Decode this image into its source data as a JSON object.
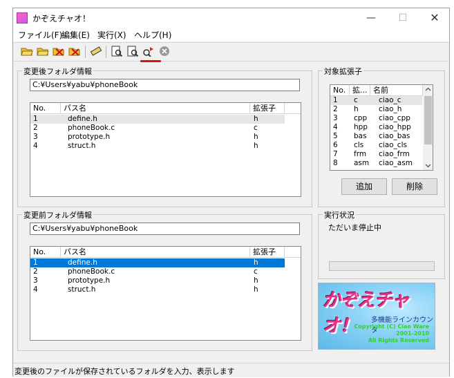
{
  "window": {
    "title": "かぞえチャオ！",
    "min_glyph": "—",
    "max_glyph": "☐",
    "close_glyph": "✕"
  },
  "menu": {
    "items": [
      "ファイル(F)",
      "編集(E)",
      "実行(X)",
      "ヘルプ(H)"
    ]
  },
  "toolbar": {
    "icons": [
      "open-folder-icon",
      "open-folder-icon",
      "remove-folder-icon",
      "remove-folder-icon",
      "ruler-icon",
      "preview-icon",
      "preview-icon",
      "count-run-icon",
      "stop-icon"
    ],
    "accent_red": "#e01010"
  },
  "after_folder": {
    "title": "変更後フォルダ情報",
    "path": "C:¥Users¥yabu¥phoneBook",
    "columns": [
      "No.",
      "パス名",
      "拡張子"
    ],
    "rows": [
      {
        "no": "1",
        "path": "define.h",
        "ext": "h"
      },
      {
        "no": "2",
        "path": "phoneBook.c",
        "ext": "c"
      },
      {
        "no": "3",
        "path": "prototype.h",
        "ext": "h"
      },
      {
        "no": "4",
        "path": "struct.h",
        "ext": "h"
      }
    ]
  },
  "before_folder": {
    "title": "変更前フォルダ情報",
    "path": "C:¥Users¥yabu¥phoneBook",
    "columns": [
      "No.",
      "パス名",
      "拡張子"
    ],
    "rows": [
      {
        "no": "1",
        "path": "define.h",
        "ext": "h"
      },
      {
        "no": "2",
        "path": "phoneBook.c",
        "ext": "c"
      },
      {
        "no": "3",
        "path": "prototype.h",
        "ext": "h"
      },
      {
        "no": "4",
        "path": "struct.h",
        "ext": "h"
      }
    ]
  },
  "extensions": {
    "title": "対象拡張子",
    "columns": [
      "No.",
      "拡...",
      "名前"
    ],
    "rows": [
      {
        "no": "1",
        "ext": "c",
        "name": "ciao_c"
      },
      {
        "no": "2",
        "ext": "h",
        "name": "ciao_h"
      },
      {
        "no": "3",
        "ext": "cpp",
        "name": "ciao_cpp"
      },
      {
        "no": "4",
        "ext": "hpp",
        "name": "ciao_hpp"
      },
      {
        "no": "5",
        "ext": "bas",
        "name": "ciao_bas"
      },
      {
        "no": "6",
        "ext": "cls",
        "name": "ciao_cls"
      },
      {
        "no": "7",
        "ext": "frm",
        "name": "ciao_frm"
      },
      {
        "no": "8",
        "ext": "asm",
        "name": "ciao_asm"
      }
    ],
    "add_label": "追加",
    "delete_label": "削除"
  },
  "execution": {
    "title": "実行状況",
    "status": "ただいま停止中",
    "progress": 0
  },
  "logo": {
    "title": "かぞえチャオ！",
    "subtitle": "多機能ラインカウンタ",
    "copyright_lines": [
      "Copyright (C) Ciao Ware",
      "2001-2010",
      "All Rights Reserved"
    ]
  },
  "statusbar": {
    "text": "変更後のファイルが保存されているフォルダを入力、表示します"
  }
}
